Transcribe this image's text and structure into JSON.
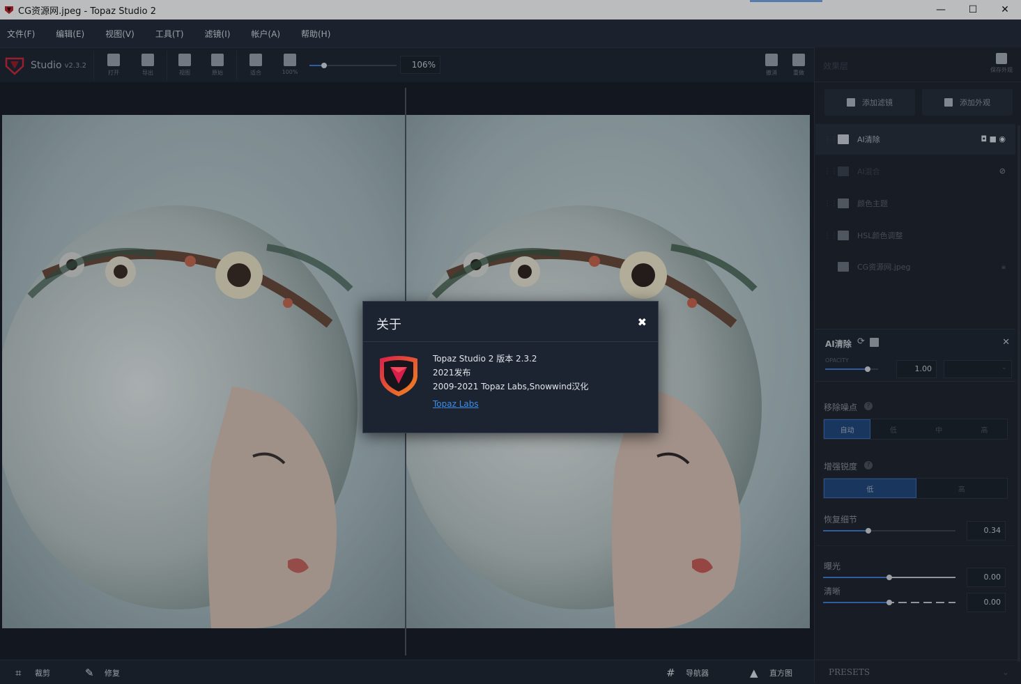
{
  "window": {
    "title": "CG资源网.jpeg - Topaz Studio 2",
    "controls": [
      "—",
      "☐",
      "✕"
    ]
  },
  "menu": [
    "文件(F)",
    "编辑(E)",
    "视图(V)",
    "工具(T)",
    "滤镜(I)",
    "帐户(A)",
    "帮助(H)"
  ],
  "toolbar": {
    "app_name": "Studio",
    "version": "v2.3.2",
    "buttons": [
      "打开",
      "导出",
      "视图",
      "原始",
      "适合",
      "100%"
    ],
    "zoom_value": "106%",
    "undo": "撤消",
    "redo": "重做"
  },
  "right_panel": {
    "header": "效果层",
    "save_look": "保存外观",
    "add_filter": "添加滤镜",
    "add_look": "添加外观",
    "layers": [
      {
        "label": "AI清除",
        "icon": "magic-wand-icon",
        "active": true
      },
      {
        "label": "AI混合",
        "icon": "swap-icon",
        "active": false
      },
      {
        "label": "颜色主题",
        "icon": "palette-icon",
        "active": false
      },
      {
        "label": "HSL颜色调整",
        "icon": "rainbow-icon",
        "active": false
      },
      {
        "label": "CG资源网.jpeg",
        "icon": "image-icon",
        "active": false
      }
    ],
    "filter_panel": {
      "title": "AI清除",
      "opacity_label": "OPACITY",
      "opacity_value": "1.00",
      "opacity_fraction": 0.8,
      "remove_noise_label": "移除噪点",
      "remove_noise_options": [
        "自动",
        "低",
        "中",
        "高"
      ],
      "remove_noise_selected": 0,
      "sharpen_label": "增强锐度",
      "sharpen_options": [
        "低",
        "高"
      ],
      "sharpen_selected": 0,
      "detail_label": "恢复细节",
      "detail_value": "0.34",
      "detail_fraction": 0.34,
      "exposure_label": "曝光",
      "exposure_value": "0.00",
      "exposure_fraction": 0.5,
      "clarity_label": "清晰",
      "clarity_value": "0.00",
      "clarity_fraction": 0.5
    },
    "presets": "PRESETS"
  },
  "bottom_bar": {
    "crop": "裁剪",
    "repair": "修复",
    "navigator": "导航器",
    "histogram": "直方图"
  },
  "about_dialog": {
    "title": "关于",
    "line1": "Topaz Studio 2 版本 2.3.2",
    "line2": "2021发布",
    "line3": "2009-2021 Topaz Labs,Snowwind汉化",
    "link": "Topaz Labs"
  },
  "colors": {
    "accent": "#3f7bd6",
    "panel_bg": "#1c222c",
    "link": "#3b8fe8"
  }
}
